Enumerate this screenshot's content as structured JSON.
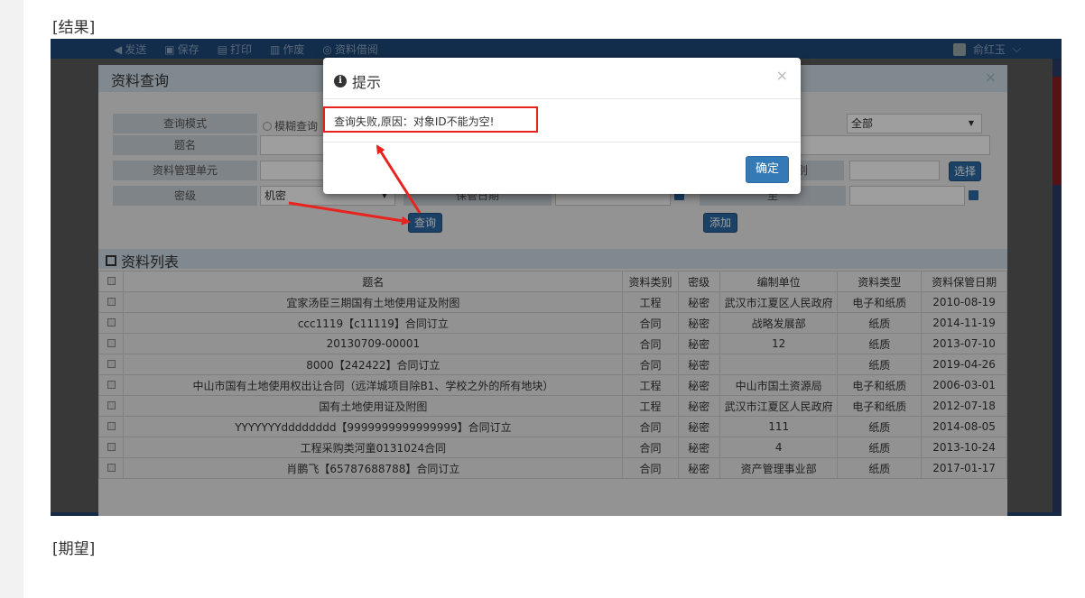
{
  "labels": {
    "result": "[结果]",
    "expected": "[期望]"
  },
  "appbar": {
    "menu": [
      "发送",
      "保存",
      "打印",
      "作废",
      "资料借阅"
    ],
    "user": "俞红玉"
  },
  "dialog": {
    "title": "资料查询",
    "close": "×"
  },
  "form": {
    "mode_label": "查询模式",
    "mode_option": "模糊查询",
    "title_label": "题名",
    "unit_label": "资料管理单元",
    "secret_label": "密级",
    "secret_value": "机密",
    "keep_date_label": "保管日期",
    "to_label": "至",
    "type_value": "全部",
    "category_label_partial": "别",
    "select_btn": "选择",
    "query_btn": "查询",
    "add_btn": "添加"
  },
  "list": {
    "title": "资料列表",
    "columns": [
      "题名",
      "资料类别",
      "密级",
      "编制单位",
      "资料类型",
      "资料保管日期"
    ],
    "rows": [
      [
        "宜家汤臣三期国有土地使用证及附图",
        "工程",
        "秘密",
        "武汉市江夏区人民政府",
        "电子和纸质",
        "2010-08-19"
      ],
      [
        "ccc1119【c11119】合同订立",
        "合同",
        "秘密",
        "战略发展部",
        "纸质",
        "2014-11-19"
      ],
      [
        "20130709-00001",
        "合同",
        "秘密",
        "12",
        "纸质",
        "2013-07-10"
      ],
      [
        "8000【242422】合同订立",
        "合同",
        "秘密",
        "",
        "纸质",
        "2019-04-26"
      ],
      [
        "中山市国有土地使用权出让合同（远洋城项目除B1、学校之外的所有地块）",
        "工程",
        "秘密",
        "中山市国土资源局",
        "电子和纸质",
        "2006-03-01"
      ],
      [
        "国有土地使用证及附图",
        "工程",
        "秘密",
        "武汉市江夏区人民政府",
        "电子和纸质",
        "2012-07-18"
      ],
      [
        "YYYYYYYdddddddd【9999999999999999】合同订立",
        "合同",
        "秘密",
        "111",
        "纸质",
        "2014-08-05"
      ],
      [
        "工程采购类河童0131024合同",
        "合同",
        "秘密",
        "4",
        "纸质",
        "2013-10-24"
      ],
      [
        "肖鹏飞【65787688788】合同订立",
        "合同",
        "秘密",
        "资产管理事业部",
        "纸质",
        "2017-01-17"
      ]
    ]
  },
  "alert": {
    "title": "提示",
    "close": "×",
    "message": "查询失败,原因：对象ID不能为空!",
    "ok": "确定"
  },
  "annotation_color": "#e8231e"
}
